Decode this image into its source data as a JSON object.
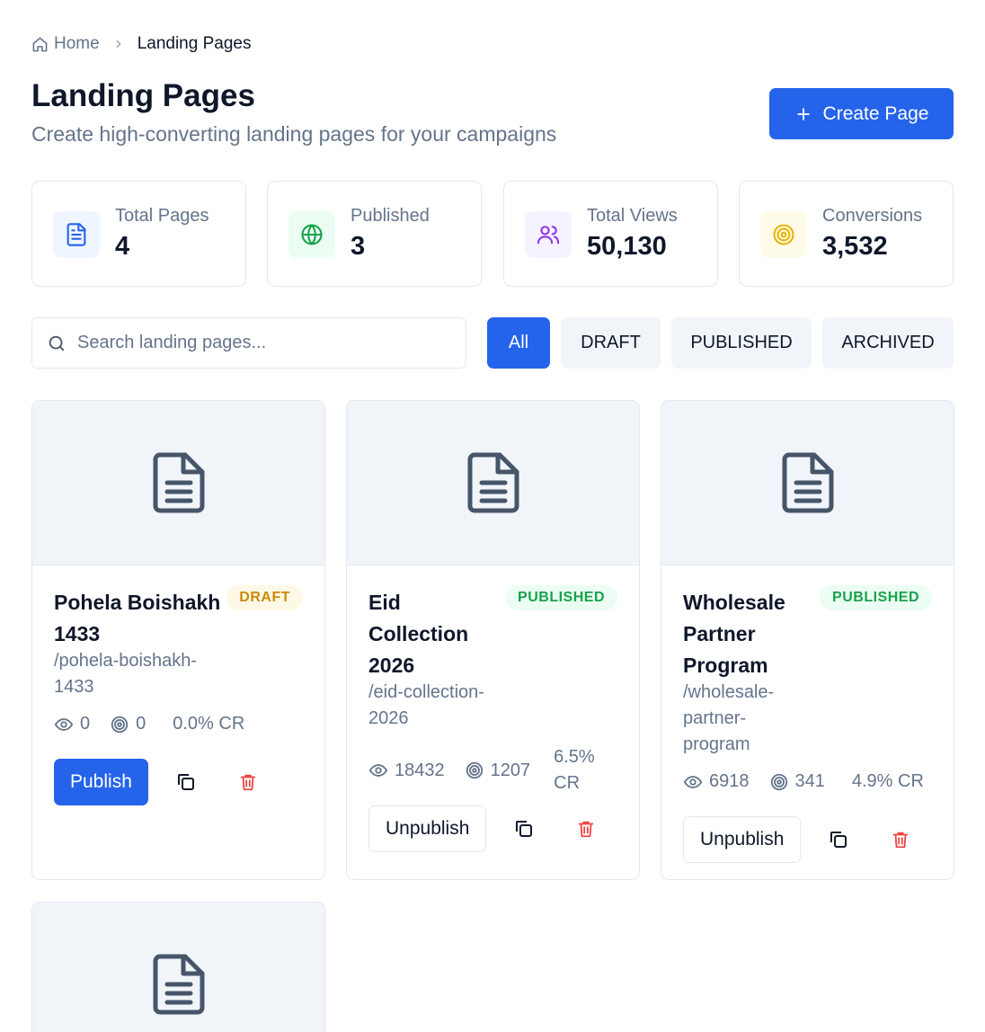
{
  "breadcrumb": {
    "home": "Home",
    "current": "Landing Pages"
  },
  "header": {
    "title": "Landing Pages",
    "subtitle": "Create high-converting landing pages for your campaigns",
    "create_label": "Create Page"
  },
  "stats": [
    {
      "label": "Total Pages",
      "value": "4",
      "icon": "document-icon",
      "color": "#2563eb",
      "bg": "#eff6ff"
    },
    {
      "label": "Published",
      "value": "3",
      "icon": "globe-icon",
      "color": "#16a34a",
      "bg": "#ecfdf3"
    },
    {
      "label": "Total Views",
      "value": "50,130",
      "icon": "users-icon",
      "color": "#9333ea",
      "bg": "#f5f3ff"
    },
    {
      "label": "Conversions",
      "value": "3,532",
      "icon": "target-icon",
      "color": "#eab308",
      "bg": "#fefce8"
    }
  ],
  "search": {
    "placeholder": "Search landing pages..."
  },
  "filters": [
    "All",
    "DRAFT",
    "PUBLISHED",
    "ARCHIVED"
  ],
  "active_filter": "All",
  "pages": [
    {
      "title_lines": [
        "Pohela Boishakh",
        "1433"
      ],
      "slug_lines": [
        "/pohela-boishakh-",
        "1433"
      ],
      "status": "DRAFT",
      "views": "0",
      "conversions": "0",
      "cr_lines": [
        "0.0% CR"
      ],
      "action": "Publish"
    },
    {
      "title_lines": [
        "Eid",
        "Collection",
        "2026"
      ],
      "slug_lines": [
        "/eid-collection-",
        "2026"
      ],
      "status": "PUBLISHED",
      "views": "18432",
      "conversions": "1207",
      "cr_lines": [
        "6.5%",
        "CR"
      ],
      "action": "Unpublish"
    },
    {
      "title_lines": [
        "Wholesale",
        "Partner",
        "Program"
      ],
      "slug_lines": [
        "/wholesale-",
        "partner-",
        "program"
      ],
      "status": "PUBLISHED",
      "views": "6918",
      "conversions": "341",
      "cr_lines": [
        "4.9% CR"
      ],
      "action": "Unpublish"
    }
  ]
}
